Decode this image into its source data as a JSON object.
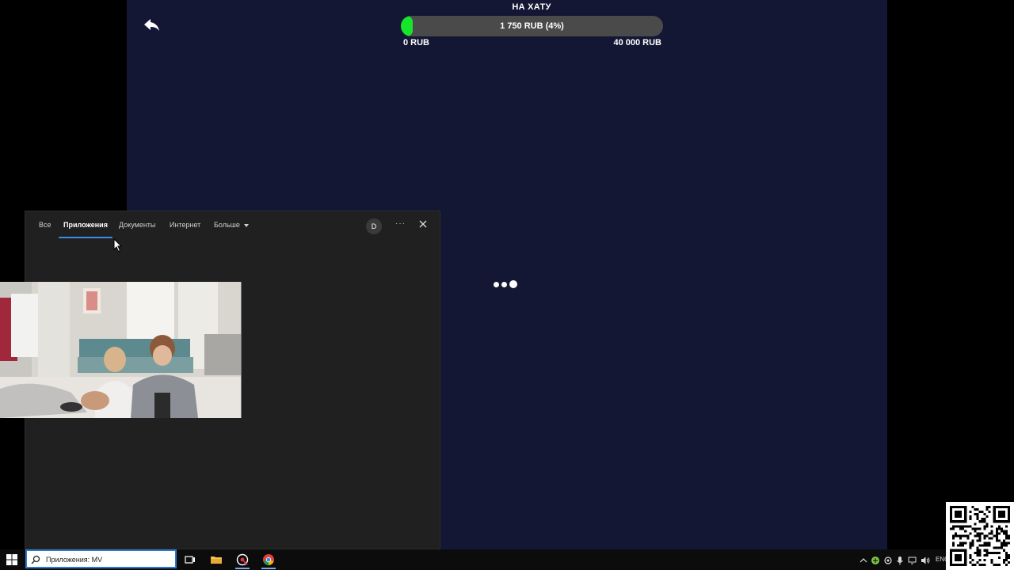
{
  "overlay": {
    "goal_title": "НА ХАТУ",
    "goal_amount": "1 750 RUB (4%)",
    "goal_progress_percent": 4,
    "goal_min": "0 RUB",
    "goal_max": "40 000 RUB",
    "colors": {
      "background": "#131733",
      "progress_fill": "#17e52c",
      "progress_track": "#4a4a4a"
    }
  },
  "search_panel": {
    "tabs": [
      {
        "label": "Все",
        "active": false
      },
      {
        "label": "Приложения",
        "active": true
      },
      {
        "label": "Документы",
        "active": false
      },
      {
        "label": "Интернет",
        "active": false
      },
      {
        "label": "Больше",
        "active": false
      }
    ],
    "avatar_letter": "D",
    "more_label": "···"
  },
  "taskbar": {
    "search_value": "Приложения: MV",
    "language": "ENG",
    "icons": [
      "windows-start-icon",
      "task-view-icon",
      "file-explorer-icon",
      "capture-app-icon",
      "chrome-icon"
    ]
  }
}
